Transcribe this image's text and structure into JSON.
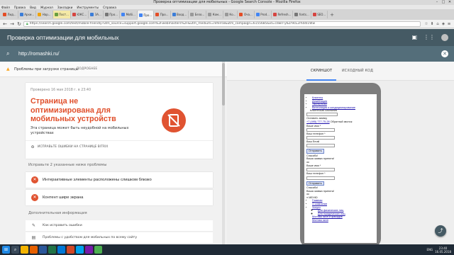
{
  "window": {
    "title": "Проверка оптимизации для мобильных - Google Search Console - Mozilla Firefox"
  },
  "menu": [
    "Файл",
    "Правка",
    "Вид",
    "Журнал",
    "Закладки",
    "Инструменты",
    "Справка"
  ],
  "tabs": [
    {
      "label": "Лид...",
      "color": "#e44d26"
    },
    {
      "label": "Архи...",
      "color": "#3b7dd8"
    },
    {
      "label": "Нар...",
      "color": "#f0a30a"
    },
    {
      "label": "Пост...",
      "color": "#6a9e3f",
      "highlight": true
    },
    {
      "label": "ЮКС...",
      "color": "#d64541"
    },
    {
      "label": "ЗА...",
      "color": "#3b7dd8"
    },
    {
      "label": "Про...",
      "color": "#777777"
    },
    {
      "label": "Мобі...",
      "color": "#4285f4"
    },
    {
      "label": "Про...",
      "color": "#4285f4",
      "active": true
    },
    {
      "label": "Про...",
      "color": "#e44d26"
    },
    {
      "label": "Вход...",
      "color": "#3b7dd8"
    },
    {
      "label": "Безо...",
      "color": "#999999"
    },
    {
      "label": "Ком...",
      "color": "#999999"
    },
    {
      "label": "Ко...",
      "color": "#999999"
    },
    {
      "label": "Оча...",
      "color": "#e44d26"
    },
    {
      "label": "Prod...",
      "color": "#4285f4"
    },
    {
      "label": "Refresh...",
      "color": "#d64541"
    },
    {
      "label": "fonts...",
      "color": "#777777"
    },
    {
      "label": "SEO...",
      "color": "#d64541"
    }
  ],
  "address": {
    "url": "https://search.google.com/test/mobile-friendly?utm_source=support.google.com%2Fwebmasters%2F&utm_medium=referral&utm_campaign=6155685&id=cdwrr-y6Zr9cE2rhd4l1Ww"
  },
  "app": {
    "title": "Проверка оптимизации для мобильных",
    "tested_url": "http://romashki.ru/"
  },
  "issues_bar": {
    "text": "Проблемы при загрузке страницы",
    "more": "ПОДРОБНЕЕ"
  },
  "result_card": {
    "checked": "Проверено 16 мая 2018 г. в 23:40",
    "headline": "Страница не оптимизирована для мобильных устройств",
    "description": "Эта страница может быть неудобной на мобильных устройствах",
    "fix_label": "ИСПРАВЬТЕ ОШИБКИ НА СТРАНИЦЕ BITRIX"
  },
  "problems": {
    "heading": "Исправьте 2 указанные ниже проблемы",
    "items": [
      "Интерактивные элементы расположены слишком близко",
      "Контент шире экрана"
    ]
  },
  "additional": {
    "heading": "Дополнительная информация",
    "items": [
      "Как исправить ошибки",
      "Проблемы с удобством для мобильных по всему сайту"
    ]
  },
  "preview": {
    "tab_screenshot": "СКРИНШОТ",
    "tab_source": "ИСХОДНЫЙ КОД",
    "nav_links": [
      "Клиенты",
      "Дизайнация",
      "Экспертизы",
      "Вентиляция и кондиционирование"
    ],
    "company": "Клиентская компания",
    "leave_request": "Оставить заявку",
    "phone": "+7 (495) 777-75-28",
    "callback": "Обратный звонок",
    "name_label": "Ваше имя *",
    "phone_label": "Ваш телефон *",
    "email_label": "Ваш Email",
    "submit": "Отправить",
    "thanks": "Спасибо!",
    "accepted": "Ваша заявка принята!",
    "ok": "ок",
    "name_label2": "Ваше имя *",
    "phone_label2": "Ваш телефон *",
    "submit2": "Отправить",
    "thanks2": "Спасибо!",
    "accepted2": "Ваша заявка принята!",
    "ok2": "ок",
    "menu_label": "≡ МЕНЮ",
    "menu_links": [
      "Главная",
      "О компании",
      "Услуги",
      "Для физических лиц",
      "Для юридических лиц",
      "Монтаж окон и фасадов",
      "Монтаж окон"
    ]
  },
  "taskbar": {
    "lang": "ENG",
    "time": "23:40",
    "date": "16.05.2018"
  }
}
